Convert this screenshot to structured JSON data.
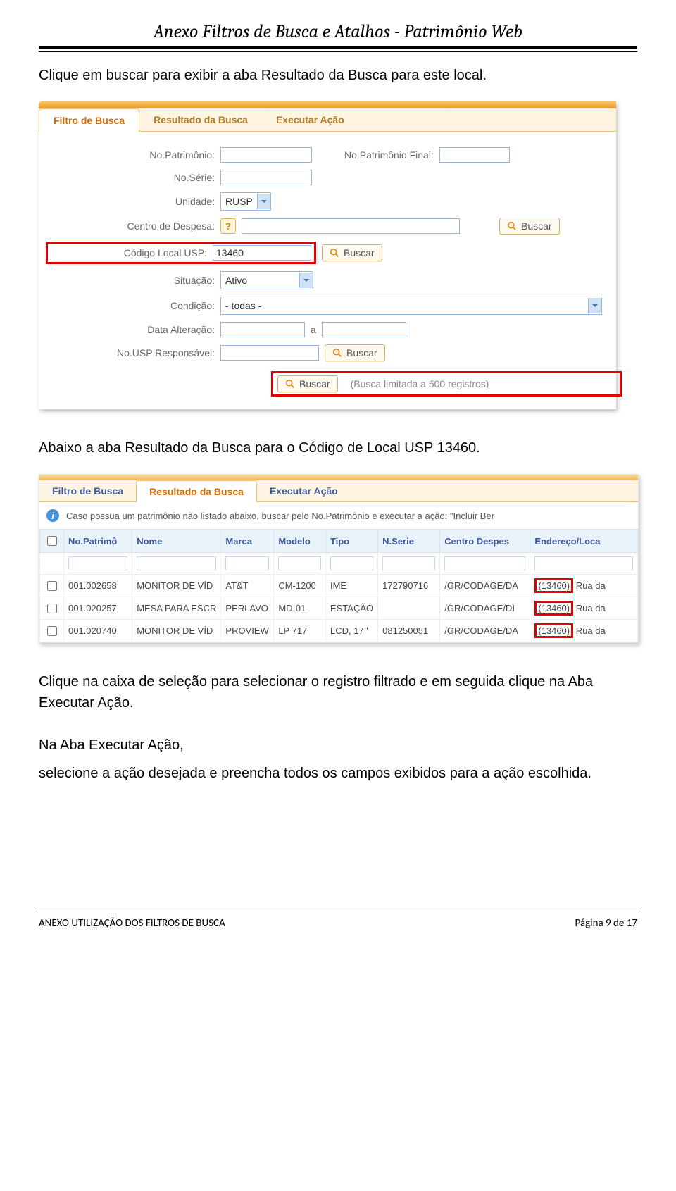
{
  "doc": {
    "title": "Anexo Filtros de Busca e Atalhos - Patrimônio Web",
    "p1": "Clique em buscar para exibir a aba Resultado da Busca para este local.",
    "p2": "Abaixo a aba Resultado da Busca para o Código de Local USP 13460.",
    "p3": "Clique na caixa de seleção para selecionar o registro filtrado e em seguida clique na Aba Executar Ação.",
    "p4": "Na Aba Executar Ação,",
    "p5": "selecione a ação desejada e preencha todos os campos exibidos para a ação escolhida."
  },
  "footer": {
    "left": "ANEXO UTILIZAÇÃO DOS FILTROS DE BUSCA",
    "right": "Página 9 de 17"
  },
  "ss1": {
    "tabs": {
      "filtro": "Filtro de Busca",
      "resultado": "Resultado da Busca",
      "executar": "Executar Ação"
    },
    "labels": {
      "no_patrimonio": "No.Patrimônio:",
      "no_patrimonio_final": "No.Patrimônio Final:",
      "no_serie": "No.Série:",
      "unidade": "Unidade:",
      "centro_despesa": "Centro de Despesa:",
      "codigo_local": "Código Local USP:",
      "situacao": "Situação:",
      "condicao": "Condição:",
      "data_alteracao": "Data Alteração:",
      "between": "a",
      "no_usp_resp": "No.USP Responsável:",
      "buscar": "Buscar",
      "limit_hint": "(Busca limitada a 500 registros)"
    },
    "values": {
      "unidade": "RUSP",
      "codigo_local": "13460",
      "situacao": "Ativo",
      "condicao": "- todas -"
    }
  },
  "ss2": {
    "tabs": {
      "filtro": "Filtro de Busca",
      "resultado": "Resultado da Busca",
      "executar": "Executar Ação"
    },
    "info_prefix": "Caso possua um patrimônio não listado abaixo, buscar pelo ",
    "info_link": "No.Patrimônio",
    "info_suffix": " e executar a ação: \"Incluir Ber",
    "headers": {
      "chk": "",
      "no_patrimo": "No.Patrimô",
      "nome": "Nome",
      "marca": "Marca",
      "modelo": "Modelo",
      "tipo": "Tipo",
      "nserie": "N.Serie",
      "centro": "Centro Despes",
      "endereco": "Endereço/Loca"
    },
    "rows": [
      {
        "no": "001.002658",
        "nome": "MONITOR DE VÍD",
        "marca": "AT&T",
        "modelo": "CM-1200",
        "tipo": "IME",
        "nserie": "172790716",
        "centro": "/GR/CODAGE/DA",
        "codloc": "(13460)",
        "end": "Rua da"
      },
      {
        "no": "001.020257",
        "nome": "MESA PARA ESCR",
        "marca": "PERLAVO",
        "modelo": "MD-01",
        "tipo": "ESTAÇÃO",
        "nserie": "",
        "centro": "/GR/CODAGE/DI",
        "codloc": "(13460)",
        "end": "Rua da"
      },
      {
        "no": "001.020740",
        "nome": "MONITOR DE VÍD",
        "marca": "PROVIEW",
        "modelo": "LP 717",
        "tipo": "LCD, 17 '",
        "nserie": "081250051",
        "centro": "/GR/CODAGE/DA",
        "codloc": "(13460)",
        "end": "Rua da"
      }
    ]
  }
}
